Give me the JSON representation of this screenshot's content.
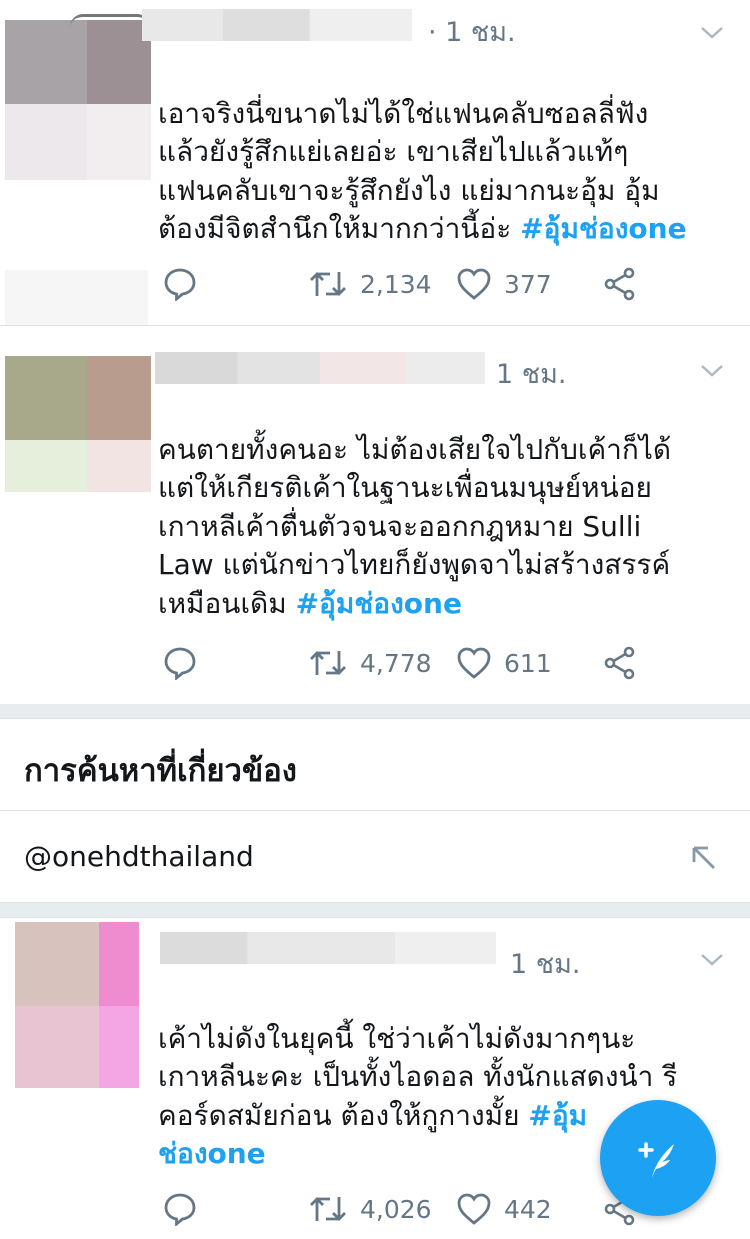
{
  "tweets": [
    {
      "time": "· 1 ชม.",
      "lines": [
        "เอาจริงนี่ขนาดไม่ได้ใช่แฟนคลับซอลลี่ฟัง",
        "แล้วยังรู้สึกแย่เลยอ่ะ เขาเสียไปแล้วแท้ๆ",
        "แฟนคลับเขาจะรู้สึกยังไง แย่มากนะอุ้ม อุ้ม",
        "ต้องมีจิตสำนึกให้มากกว่านี้อ่ะ "
      ],
      "hashtag": "#อุ้มช่องone",
      "retweets": "2,134",
      "likes": "377"
    },
    {
      "time": "1 ชม.",
      "lines": [
        "คนตายทั้งคนอะ ไม่ต้องเสียใจไปกับเค้าก็ได้",
        "แต่ให้เกียรติเค้าในฐานะเพื่อนมนุษย์หน่อย",
        "เกาหลีเค้าตื่นตัวจนจะออกกฎหมาย Sulli",
        "Law แต่นักข่าวไทยก็ยังพูดจาไม่สร้างสรรค์",
        "เหมือนเดิม "
      ],
      "hashtag": "#อุ้มช่องone",
      "retweets": "4,778",
      "likes": "611"
    },
    {
      "time": "1 ชม.",
      "lines": [
        "เค้าไม่ดังในยุคนี้ ใช่ว่าเค้าไม่ดังมากๆนะ",
        "เกาหลีนะคะ เป็นทั้งไอดอล ทั้งนักแสดงนำ รี",
        "คอร์ดสมัยก่อน ต้องให้กูกางมั้ย "
      ],
      "hashtag_parts": [
        "#อุ้ม",
        "ช่องone"
      ],
      "retweets": "4,026",
      "likes": "442"
    }
  ],
  "related": {
    "title": "การค้นหาที่เกี่ยวข้อง",
    "item": "@onehdthailand"
  },
  "icons": {
    "reply": "reply-icon",
    "retweet": "retweet-icon",
    "like": "heart-icon",
    "share": "share-icon",
    "caret": "chevron-down-icon",
    "arrow": "arrow-up-left-icon",
    "compose": "compose-tweet-icon"
  },
  "colors": {
    "accent": "#1da1f2",
    "secondary_text": "#657786",
    "divider": "#e6ecf0"
  }
}
